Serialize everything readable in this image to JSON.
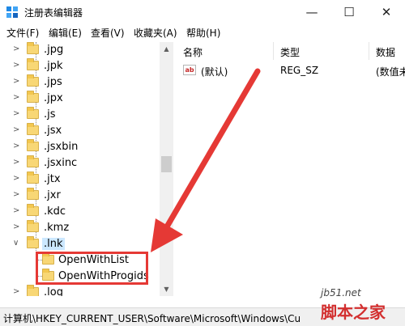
{
  "window": {
    "title": "注册表编辑器"
  },
  "menu": [
    "文件(F)",
    "编辑(E)",
    "查看(V)",
    "收藏夹(A)",
    "帮助(H)"
  ],
  "tree": {
    "items": [
      ".jpg",
      ".jpk",
      ".jps",
      ".jpx",
      ".js",
      ".jsx",
      ".jsxbin",
      ".jsxinc",
      ".jtx",
      ".jxr",
      ".kdc",
      ".kmz"
    ],
    "selected": ".lnk",
    "children": [
      "OpenWithList",
      "OpenWithProgids"
    ],
    "partial_next": ".log"
  },
  "list": {
    "headers": {
      "name": "名称",
      "type": "类型",
      "data": "数据"
    },
    "rows": [
      {
        "icon": "ab",
        "name": "(默认)",
        "type": "REG_SZ",
        "data": "(数值未"
      }
    ]
  },
  "status": {
    "path": "计算机\\HKEY_CURRENT_USER\\Software\\Microsoft\\Windows\\Cu"
  },
  "watermark": {
    "site": "jb51.net",
    "text": "脚本之家"
  },
  "colors": {
    "annotation": "#e53935",
    "selection": "#cce8ff",
    "folder": "#f8d775"
  }
}
